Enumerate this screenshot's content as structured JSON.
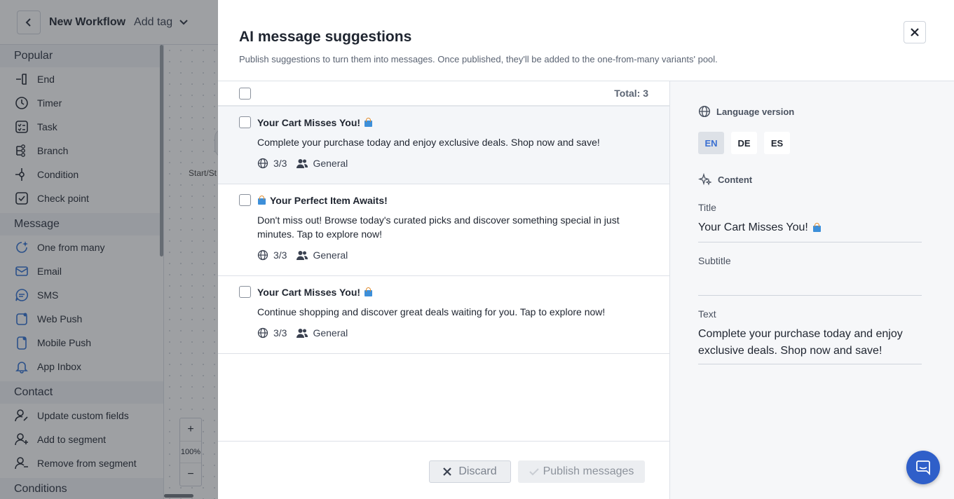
{
  "app": {
    "workflow_title": "New Workflow",
    "add_tag_label": "Add tag",
    "sidebar": {
      "sections": [
        {
          "title": "Popular",
          "items": [
            {
              "label": "End",
              "icon": "end-icon"
            },
            {
              "label": "Timer",
              "icon": "timer-icon"
            },
            {
              "label": "Task",
              "icon": "task-icon"
            },
            {
              "label": "Branch",
              "icon": "branch-icon"
            },
            {
              "label": "Condition",
              "icon": "condition-icon"
            },
            {
              "label": "Check point",
              "icon": "checkpoint-icon"
            }
          ]
        },
        {
          "title": "Message",
          "items": [
            {
              "label": "One from many",
              "icon": "sparkle-message-icon"
            },
            {
              "label": "Email",
              "icon": "email-icon"
            },
            {
              "label": "SMS",
              "icon": "sms-icon"
            },
            {
              "label": "Web Push",
              "icon": "web-push-icon"
            },
            {
              "label": "Mobile Push",
              "icon": "mobile-push-icon"
            },
            {
              "label": "App Inbox",
              "icon": "bell-icon"
            }
          ]
        },
        {
          "title": "Contact",
          "items": [
            {
              "label": "Update custom fields",
              "icon": "user-edit-icon"
            },
            {
              "label": "Add to segment",
              "icon": "user-add-icon"
            },
            {
              "label": "Remove from segment",
              "icon": "user-remove-icon"
            }
          ]
        },
        {
          "title": "Conditions",
          "items": []
        }
      ]
    },
    "canvas": {
      "node_label": "Start/St",
      "zoom_in": "+",
      "zoom_level": "100%",
      "zoom_out": "−"
    }
  },
  "modal": {
    "title": "AI message suggestions",
    "subtitle": "Publish suggestions to turn them into messages. Once published, they'll be added to the one-from-many variants' pool.",
    "total_label": "Total: 3",
    "suggestions": [
      {
        "title": "Your Cart Misses You!",
        "emoji_position": "after",
        "text": "Complete your purchase today and enjoy exclusive deals. Shop now and save!",
        "languages": "3/3",
        "segment": "General"
      },
      {
        "title": "Your Perfect Item Awaits!",
        "emoji_position": "before",
        "text": "Don't miss out! Browse today's curated picks and discover something special in just minutes. Tap to explore now!",
        "languages": "3/3",
        "segment": "General"
      },
      {
        "title": "Your Cart Misses You!",
        "emoji_position": "after",
        "text": "Continue shopping and discover great deals waiting for you. Tap to explore now!",
        "languages": "3/3",
        "segment": "General"
      }
    ],
    "discard_label": "Discard",
    "publish_label": "Publish messages",
    "detail": {
      "language_version_label": "Language version",
      "languages": [
        "EN",
        "DE",
        "ES"
      ],
      "selected_language": "EN",
      "content_label": "Content",
      "title_label": "Title",
      "title_value": "Your Cart Misses You!",
      "subtitle_label": "Subtitle",
      "subtitle_value": "",
      "text_label": "Text",
      "text_value": "Complete your purchase today and enjoy exclusive deals. Shop now and save!"
    }
  },
  "colors": {
    "accent": "#3a6fd1",
    "chat_button": "#2f5fc9",
    "overlay": "#282c34"
  }
}
